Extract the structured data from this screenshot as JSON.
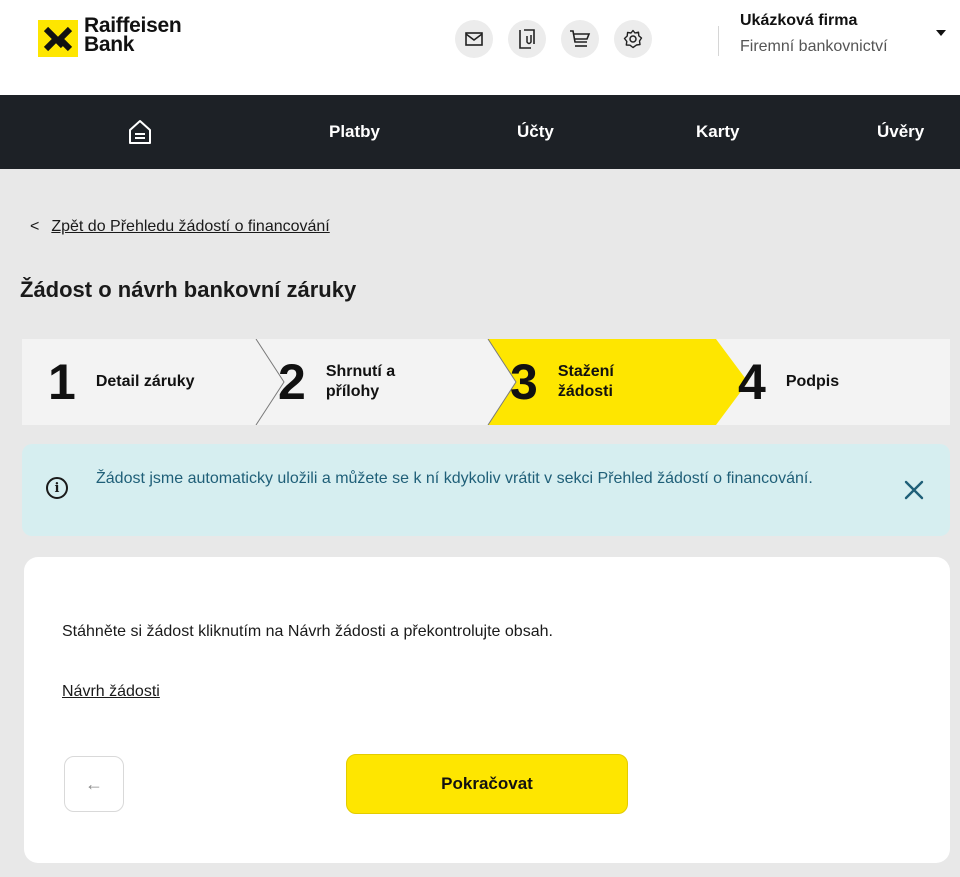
{
  "header": {
    "brand_line1": "Raiffeisen",
    "brand_line2": "Bank",
    "icons": [
      "mail-icon",
      "documents-icon",
      "cart-icon",
      "settings-icon"
    ],
    "company_name": "Ukázková firma",
    "company_sub": "Firemní bankovnictví"
  },
  "nav": {
    "items": [
      "Platby",
      "Účty",
      "Karty",
      "Úvěry"
    ]
  },
  "page": {
    "back_link": "Zpět do Přehledu žádostí o financování",
    "title": "Žádost o návrh bankovní záruky"
  },
  "stepper": {
    "steps": [
      {
        "num": "1",
        "label_line1": "Detail záruky",
        "label_line2": ""
      },
      {
        "num": "2",
        "label_line1": "Shrnutí a",
        "label_line2": "přílohy"
      },
      {
        "num": "3",
        "label_line1": "Stažení",
        "label_line2": "žádosti"
      },
      {
        "num": "4",
        "label_line1": "Podpis",
        "label_line2": ""
      }
    ],
    "active_step": 3
  },
  "banner": {
    "text": "Žádost jsme automaticky uložili a můžete se k ní kdykoliv vrátit v sekci  Přehled žádostí o financování."
  },
  "card": {
    "instruction": "Stáhněte si žádost kliknutím na Návrh žádosti a překontrolujte obsah.",
    "draft_link": "Návrh žádosti",
    "prev_button_glyph": "←",
    "continue_label": "Pokračovat"
  },
  "colors": {
    "accent": "#fee600",
    "nav_bg": "#1d2126",
    "banner_bg": "#d6eef0",
    "banner_text": "#1f5f78"
  }
}
